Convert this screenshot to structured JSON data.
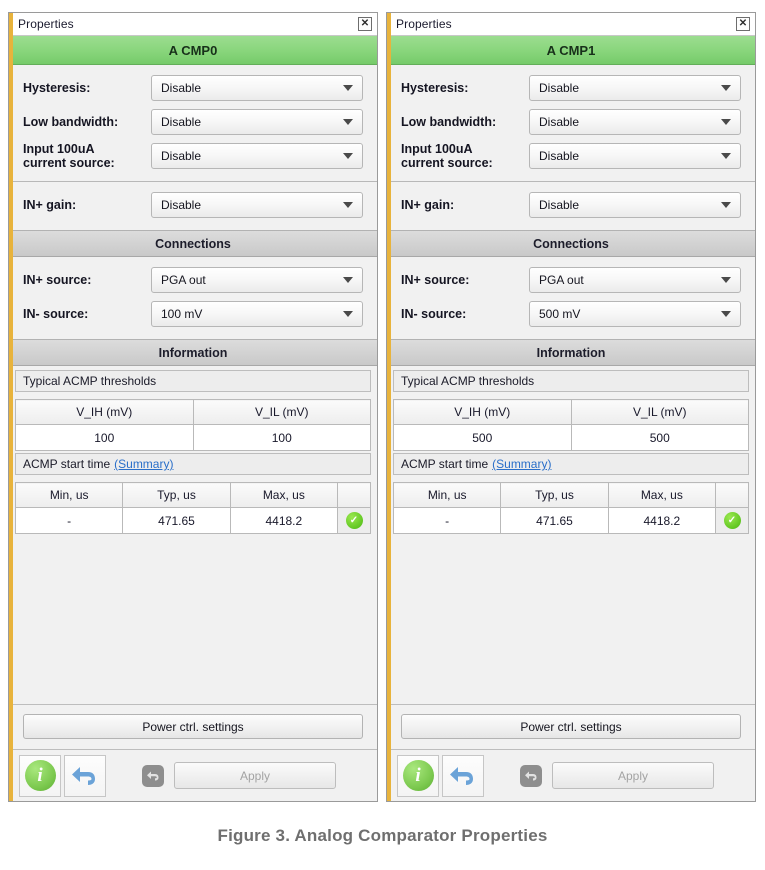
{
  "figure": {
    "caption": "Figure 3. Analog Comparator Properties"
  },
  "panels": [
    {
      "titlebar": {
        "title": "Properties",
        "close_icon": "close-icon",
        "close_glyph": "✕"
      },
      "header": "A CMP0",
      "settings": [
        {
          "label": "Hysteresis:",
          "label2": "",
          "value": "Disable"
        },
        {
          "label": "Low bandwidth:",
          "label2": "",
          "value": "Disable"
        },
        {
          "label": "Input 100uA",
          "label2": "current source:",
          "value": "Disable"
        }
      ],
      "gain": {
        "label": "IN+ gain:",
        "value": "Disable"
      },
      "connections": {
        "header": "Connections",
        "rows": [
          {
            "label": "IN+ source:",
            "value": "PGA out"
          },
          {
            "label": "IN- source:",
            "value": "100 mV"
          }
        ]
      },
      "information": {
        "header": "Information",
        "thresholds": {
          "caption": "Typical ACMP thresholds",
          "columns": [
            "V_IH (mV)",
            "V_IL (mV)"
          ],
          "values": [
            "100",
            "100"
          ]
        },
        "start_time": {
          "caption": "ACMP start time",
          "link": "(Summary)",
          "columns": [
            "Min, us",
            "Typ, us",
            "Max, us"
          ],
          "values": [
            "-",
            "471.65",
            "4418.2"
          ],
          "status_icon": "check-badge",
          "status_glyph": "✓"
        }
      },
      "footer": {
        "power_button": "Power ctrl. settings",
        "info_icon": "info-icon",
        "info_glyph": "i",
        "undo_icon": "undo-icon",
        "reset_icon": "reset-icon",
        "apply_button": "Apply"
      }
    },
    {
      "titlebar": {
        "title": "Properties",
        "close_icon": "close-icon",
        "close_glyph": "✕"
      },
      "header": "A CMP1",
      "settings": [
        {
          "label": "Hysteresis:",
          "label2": "",
          "value": "Disable"
        },
        {
          "label": "Low bandwidth:",
          "label2": "",
          "value": "Disable"
        },
        {
          "label": "Input 100uA",
          "label2": "current source:",
          "value": "Disable"
        }
      ],
      "gain": {
        "label": "IN+ gain:",
        "value": "Disable"
      },
      "connections": {
        "header": "Connections",
        "rows": [
          {
            "label": "IN+ source:",
            "value": "PGA out"
          },
          {
            "label": "IN- source:",
            "value": "500 mV"
          }
        ]
      },
      "information": {
        "header": "Information",
        "thresholds": {
          "caption": "Typical ACMP thresholds",
          "columns": [
            "V_IH (mV)",
            "V_IL (mV)"
          ],
          "values": [
            "500",
            "500"
          ]
        },
        "start_time": {
          "caption": "ACMP start time",
          "link": "(Summary)",
          "columns": [
            "Min, us",
            "Typ, us",
            "Max, us"
          ],
          "values": [
            "-",
            "471.65",
            "4418.2"
          ],
          "status_icon": "check-badge",
          "status_glyph": "✓"
        }
      },
      "footer": {
        "power_button": "Power ctrl. settings",
        "info_icon": "info-icon",
        "info_glyph": "i",
        "undo_icon": "undo-icon",
        "reset_icon": "reset-icon",
        "apply_button": "Apply"
      }
    }
  ],
  "colors": {
    "accent_stripe": "#e8b33c",
    "header_green": "#8ad67d",
    "link_blue": "#2a6fc9",
    "status_green": "#62c723",
    "caption_gray": "#6f6f6f"
  }
}
